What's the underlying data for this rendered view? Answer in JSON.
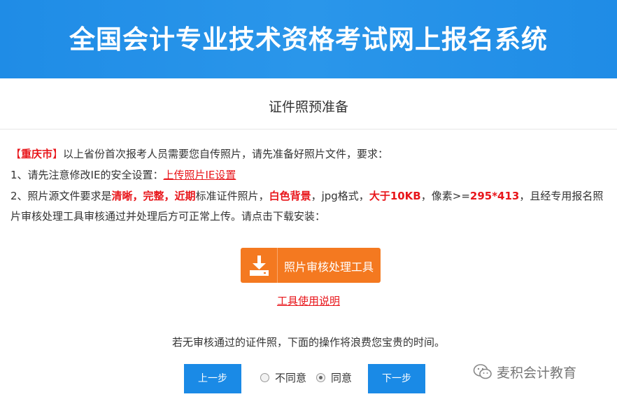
{
  "header": {
    "title": "全国会计专业技术资格考试网上报名系统"
  },
  "section": {
    "title": "证件照预准备"
  },
  "instructions": {
    "line1": {
      "bracket_open": "【",
      "region": "重庆市",
      "bracket_close": "】",
      "text": "以上省份首次报考人员需要您自传照片，请先准备好照片文件，要求："
    },
    "line2": {
      "prefix": "1、请先注意修改IE的安全设置：",
      "link": "上传照片IE设置"
    },
    "line3": {
      "p1": "2、照片源文件要求是",
      "req1": "清晰，完整，近期",
      "p2": "标准证件照片，",
      "req2": "白色背景",
      "p3": "，jpg格式，",
      "req3": "大于10KB",
      "p4": "，像素>=",
      "req4": "295*413",
      "p5": "，且经专用报名照片审核处理工具审核通过并处理后方可正常上传。请点击下载安装："
    }
  },
  "download": {
    "label": "照片审核处理工具",
    "icon": "download-icon"
  },
  "usage_link": "工具使用说明",
  "notice": "若无审核通过的证件照，下面的操作将浪费您宝贵的时间。",
  "nav": {
    "prev": "上一步",
    "next": "下一步",
    "disagree": "不同意",
    "agree": "同意",
    "selected": "agree"
  },
  "watermark": {
    "text": "麦积会计教育",
    "icon": "wechat-icon"
  },
  "colors": {
    "accent": "#1a8ae6",
    "orange": "#f47920",
    "red": "#e8161b"
  }
}
